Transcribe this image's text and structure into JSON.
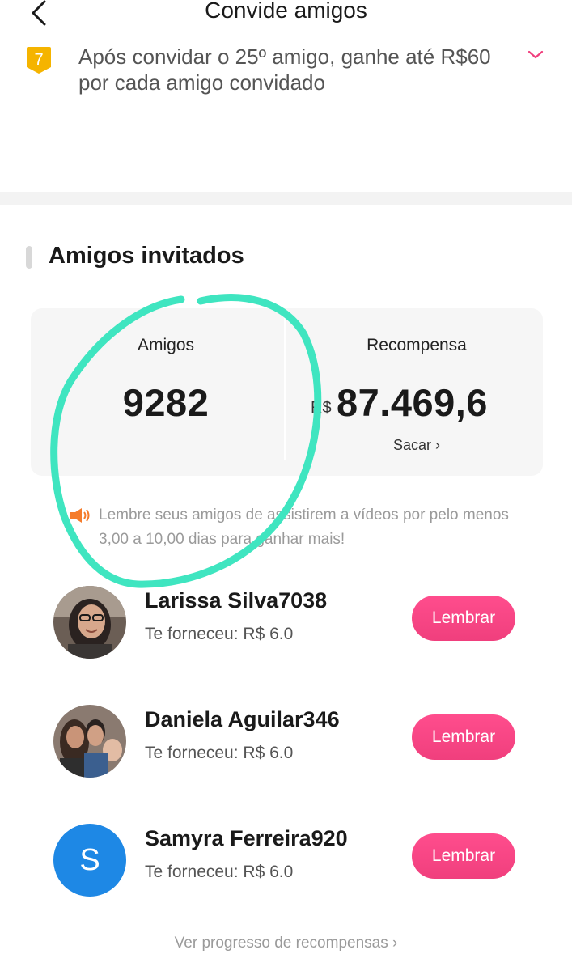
{
  "header": {
    "title": "Convide amigos"
  },
  "task": {
    "level": "7",
    "text": "Após convidar o 25º amigo, ganhe até R$60 por cada amigo convidado"
  },
  "section": {
    "title": "Amigos invitados"
  },
  "stats": {
    "friends_label": "Amigos",
    "friends_value": "9282",
    "reward_label": "Recompensa",
    "reward_currency": "R$",
    "reward_value": "87.469,6",
    "withdraw_label": "Sacar ›"
  },
  "notice": {
    "text": "Lembre seus amigos de assistirem a vídeos por pelo menos 3,00 a 10,00 dias para ganhar mais!"
  },
  "friends": [
    {
      "name": "Larissa Silva7038",
      "reward": "Te forneceu: R$ 6.0",
      "button": "Lembrar",
      "avatar": "photo"
    },
    {
      "name": "Daniela Aguilar346",
      "reward": "Te forneceu: R$ 6.0",
      "button": "Lembrar",
      "avatar": "photo"
    },
    {
      "name": "Samyra Ferreira920",
      "reward": "Te forneceu: R$ 6.0",
      "button": "Lembrar",
      "avatar_letter": "S"
    }
  ],
  "footer": {
    "link": "Ver progresso de recompensas ›"
  },
  "colors": {
    "accent": "#f03f7d",
    "badge": "#f5b400",
    "highlight": "#3fe5c0",
    "avatar_s": "#1e88e5"
  }
}
